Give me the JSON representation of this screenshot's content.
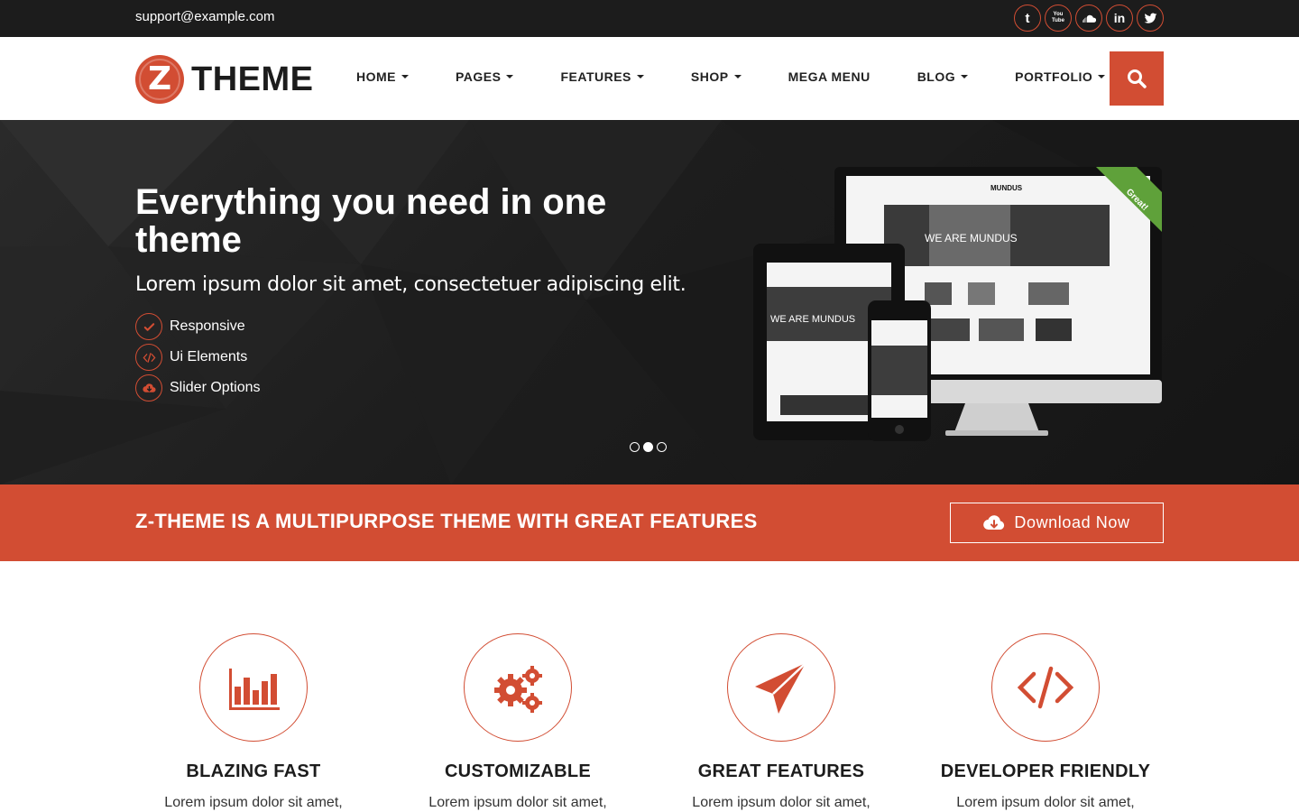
{
  "topbar": {
    "email": "support@example.com",
    "socials": [
      {
        "icon": "tumblr-icon",
        "glyph": "t"
      },
      {
        "icon": "youtube-icon",
        "glyph": "You Tube"
      },
      {
        "icon": "soundcloud-icon",
        "glyph": ""
      },
      {
        "icon": "linkedin-icon",
        "glyph": "in"
      },
      {
        "icon": "twitter-icon",
        "glyph": ""
      }
    ]
  },
  "header": {
    "logo_mark": "Z",
    "logo_text": "THEME",
    "nav": [
      {
        "label": "HOME",
        "dropdown": true
      },
      {
        "label": "PAGES",
        "dropdown": true
      },
      {
        "label": "FEATURES",
        "dropdown": true
      },
      {
        "label": "SHOP",
        "dropdown": true
      },
      {
        "label": "MEGA MENU",
        "dropdown": false
      },
      {
        "label": "BLOG",
        "dropdown": true
      },
      {
        "label": "PORTFOLIO",
        "dropdown": true
      }
    ]
  },
  "hero": {
    "title": "Everything you need in one theme",
    "subtitle": "Lorem ipsum dolor sit amet, consectetuer adipiscing elit.",
    "features": [
      {
        "label": "Responsive",
        "icon": "check-icon"
      },
      {
        "label": "Ui Elements",
        "icon": "code-icon"
      },
      {
        "label": "Slider Options",
        "icon": "cloud-download-icon"
      }
    ],
    "slides": 3,
    "active_slide": 2,
    "mockup": {
      "brand": "MUNDUS",
      "headline": "WE ARE MUNDUS",
      "ribbon": "Great!"
    }
  },
  "cta": {
    "text": "Z-THEME IS A MULTIPURPOSE THEME WITH GREAT FEATURES",
    "button_label": "Download Now"
  },
  "features": [
    {
      "title": "BLAZING FAST",
      "icon": "bar-chart-icon",
      "text": "Lorem ipsum dolor sit amet,"
    },
    {
      "title": "CUSTOMIZABLE",
      "icon": "gears-icon",
      "text": "Lorem ipsum dolor sit amet,"
    },
    {
      "title": "GREAT FEATURES",
      "icon": "paper-plane-icon",
      "text": "Lorem ipsum dolor sit amet,"
    },
    {
      "title": "DEVELOPER FRIENDLY",
      "icon": "code-icon",
      "text": "Lorem ipsum dolor sit amet,"
    }
  ],
  "colors": {
    "accent": "#d24d33",
    "topbar_bg": "#1c1c1c",
    "hero_bg": "#1e1e1e"
  }
}
